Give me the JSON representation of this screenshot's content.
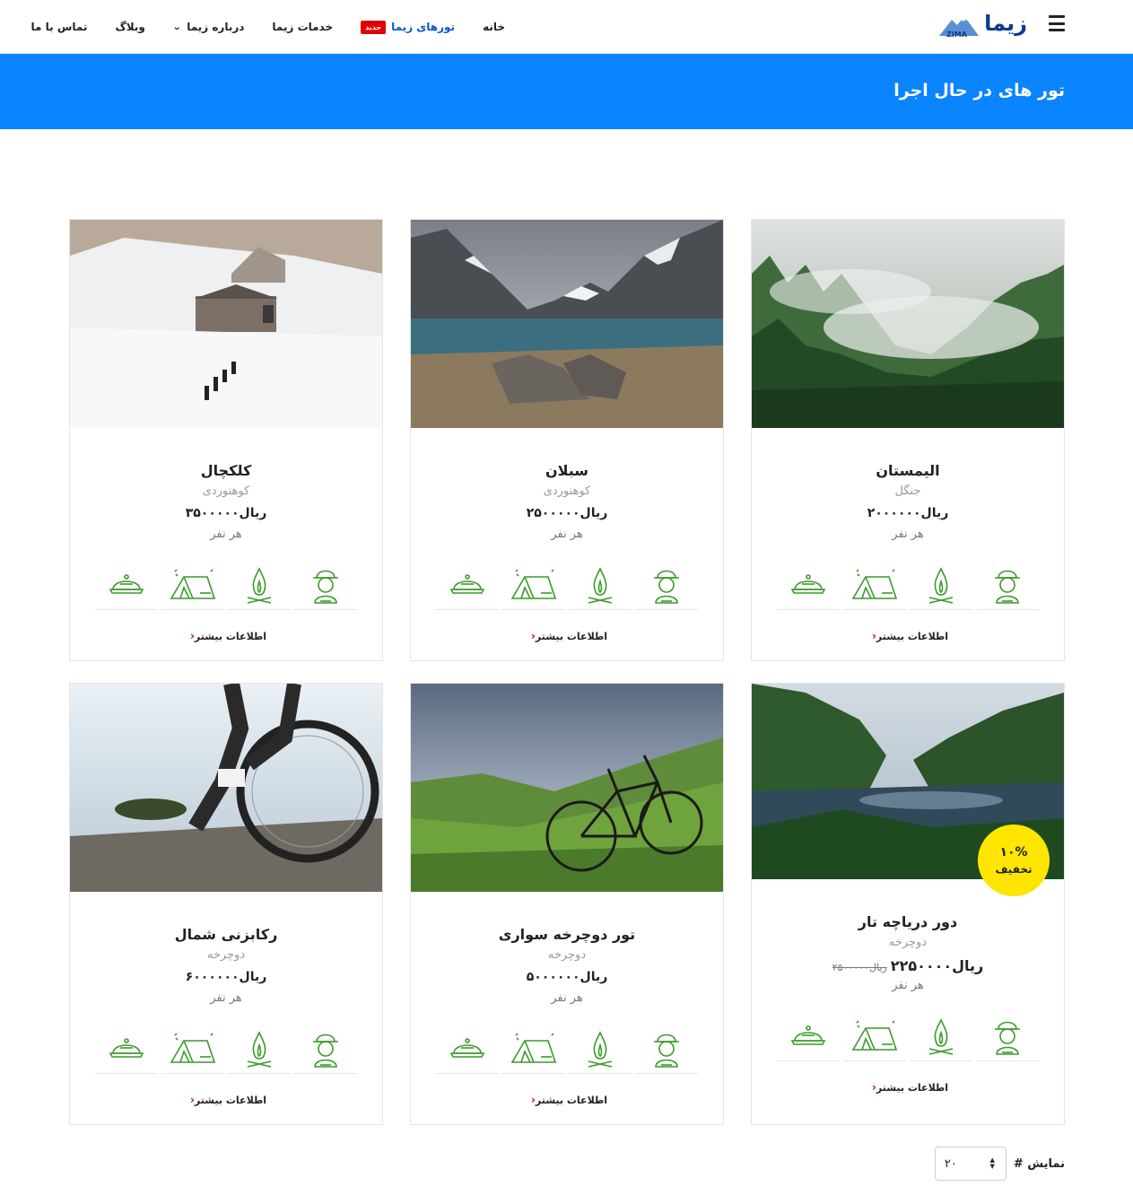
{
  "header": {
    "logo_text": "زیما",
    "logo_sub": "ZIMA",
    "nav": [
      {
        "label": "خانه"
      },
      {
        "label": "تورهای زیما",
        "badge": "جدید"
      },
      {
        "label": "خدمات زیما"
      },
      {
        "label": "درباره زیما"
      },
      {
        "label": "وبلاگ"
      },
      {
        "label": "تماس با ما"
      }
    ]
  },
  "banner": {
    "title": "تور های در حال اجرا"
  },
  "cards": [
    {
      "title": "الیمستان",
      "category": "جنگل",
      "price": "ریال۲۰۰۰۰۰۰",
      "per": "هر نفر",
      "more": "اطلاعات بیشتر",
      "image": "foggy-forest"
    },
    {
      "title": "سبلان",
      "category": "کوهنوردی",
      "price": "ریال۲۵۰۰۰۰۰",
      "per": "هر نفر",
      "more": "اطلاعات بیشتر",
      "image": "mountain-lake"
    },
    {
      "title": "کلکچال",
      "category": "کوهنوردی",
      "price": "ریال۳۵۰۰۰۰۰",
      "per": "هر نفر",
      "more": "اطلاعات بیشتر",
      "image": "snowy-hikers"
    },
    {
      "title": "دور دریاچه تار",
      "category": "دوچرخه",
      "price": "ریال۲۲۵۰۰۰۰",
      "old_price": "ریال۲۵۰۰۰۰۰",
      "per": "هر نفر",
      "more": "اطلاعات بیشتر",
      "image": "forest-lake",
      "discount_pct": "۱۰%",
      "discount_label": "تخفیف"
    },
    {
      "title": "تور دوچرخه سواری",
      "category": "دوچرخه",
      "price": "ریال۵۰۰۰۰۰۰",
      "per": "هر نفر",
      "more": "اطلاعات بیشتر",
      "image": "bike-on-hill"
    },
    {
      "title": "رکابزنی شمال",
      "category": "دوچرخه",
      "price": "ریال۶۰۰۰۰۰۰",
      "per": "هر نفر",
      "more": "اطلاعات بیشتر",
      "image": "cyclist-trail"
    }
  ],
  "icons": [
    "guide-icon",
    "campfire-icon",
    "tent-icon",
    "meal-icon"
  ],
  "colors": {
    "accent": "#0a84ff",
    "icon_green": "#3a9a2a",
    "badge_red": "#e00000",
    "discount_yellow": "#ffe600"
  },
  "pagination": {
    "label": "نمایش #",
    "value": "۲۰"
  }
}
